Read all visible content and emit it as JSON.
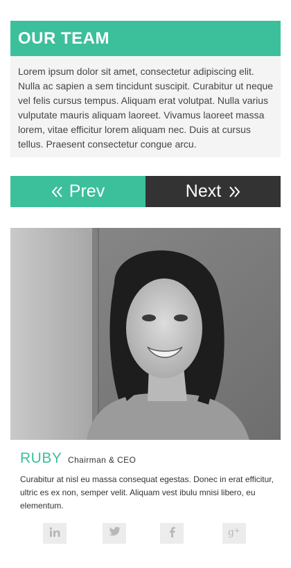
{
  "header": {
    "title": "OUR TEAM"
  },
  "intro": {
    "text": "Lorem ipsum dolor sit amet, consectetur adipiscing elit. Nulla ac sapien a sem tincidunt suscipit. Curabitur ut neque vel felis cursus tempus. Aliquam erat volutpat. Nulla varius vulputate mauris aliquam laoreet. Vivamus laoreet massa lorem, vitae efficitur lorem aliquam nec. Duis at cursus tellus. Praesent consectetur congue arcu."
  },
  "pager": {
    "prev_label": "Prev",
    "next_label": "Next"
  },
  "member": {
    "name": "RUBY",
    "role": "Chairman & CEO",
    "bio": "Curabitur at nisl eu massa consequat  egestas. Donec in erat efficitur, ultric es ex non, semper velit. Aliquam vest ibulu mnisi libero, eu elementum."
  },
  "social": [
    {
      "icon": "linkedin-icon"
    },
    {
      "icon": "twitter-icon"
    },
    {
      "icon": "facebook-icon"
    },
    {
      "icon": "google-plus-icon"
    }
  ],
  "colors": {
    "accent": "#3cbf9b",
    "dark": "#333333",
    "panel": "#f4f4f4",
    "icon": "#b8b8b8"
  }
}
